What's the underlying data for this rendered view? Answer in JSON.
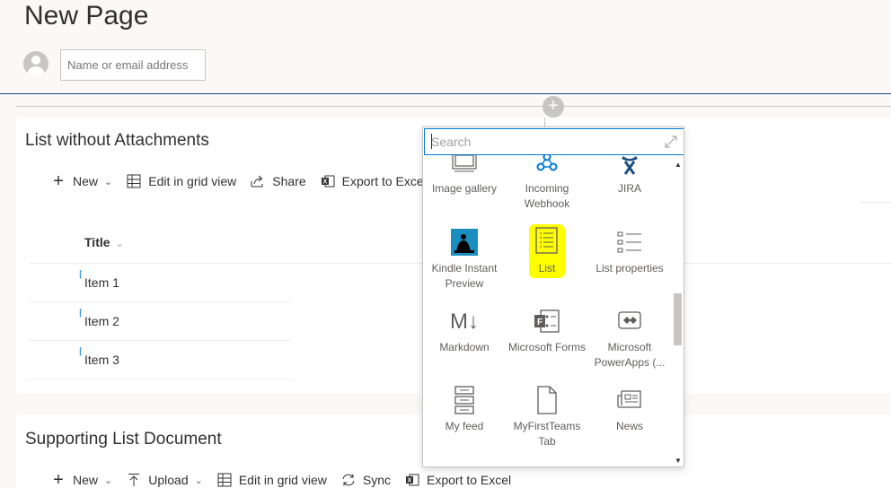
{
  "page": {
    "title": "New Page"
  },
  "author": {
    "placeholder": "Name or email address"
  },
  "section1": {
    "title": "List without Attachments",
    "toolbar": {
      "new_label": "New",
      "edit_grid_label": "Edit in grid view",
      "share_label": "Share",
      "export_label": "Export to Exce"
    },
    "column_header": "Title",
    "rows": [
      "Item 1",
      "Item 2",
      "Item 3"
    ]
  },
  "section2": {
    "title": "Supporting List Document",
    "toolbar": {
      "new_label": "New",
      "upload_label": "Upload",
      "edit_grid_label": "Edit in grid view",
      "sync_label": "Sync",
      "export_label": "Export to Excel"
    }
  },
  "picker": {
    "search_placeholder": "Search",
    "tiles": [
      {
        "label": "Image gallery",
        "icon": "image-gallery-icon"
      },
      {
        "label": "Incoming Webhook",
        "icon": "webhook-icon"
      },
      {
        "label": "JIRA",
        "icon": "jira-icon"
      },
      {
        "label": "Kindle Instant Preview",
        "icon": "kindle-icon"
      },
      {
        "label": "List",
        "icon": "list-icon",
        "highlight": "#ffff00"
      },
      {
        "label": "List properties",
        "icon": "list-properties-icon"
      },
      {
        "label": "Markdown",
        "icon": "markdown-icon"
      },
      {
        "label": "Microsoft Forms",
        "icon": "forms-icon"
      },
      {
        "label": "Microsoft PowerApps (...",
        "icon": "powerapps-icon"
      },
      {
        "label": "My feed",
        "icon": "feed-icon"
      },
      {
        "label": "MyFirstTeams Tab",
        "icon": "file-icon"
      },
      {
        "label": "News",
        "icon": "news-icon"
      }
    ]
  },
  "colors": {
    "accent": "#0078d4",
    "highlight": "#ffff00",
    "header_line": "#1f4e79"
  }
}
